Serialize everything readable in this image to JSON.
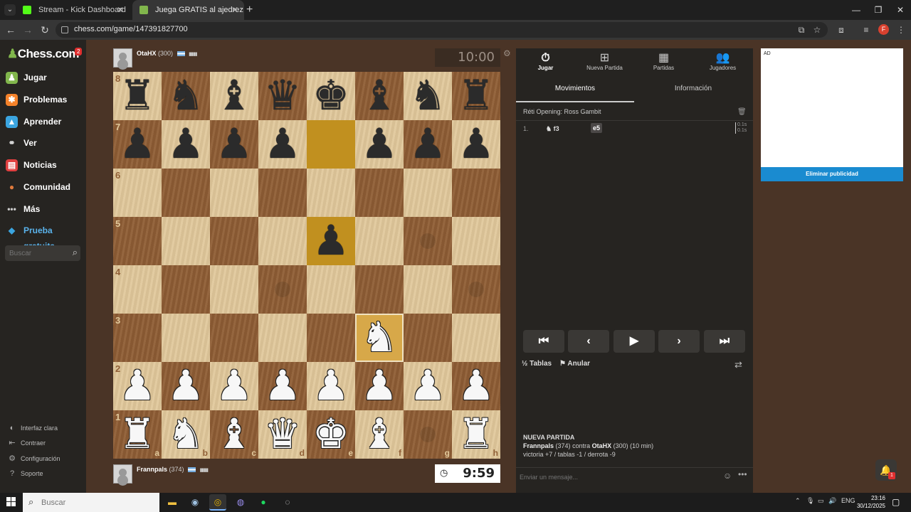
{
  "browser": {
    "tabs": [
      {
        "title": "Stream - Kick Dashboard",
        "favicon_color": "#53fc18"
      },
      {
        "title": "Juega GRATIS al ajedrez onl",
        "favicon_color": "#81b64c"
      }
    ],
    "url": "chess.com/game/147391827700"
  },
  "sidebar": {
    "logo": "Chess.com",
    "badge": "2",
    "items": [
      {
        "label": "Jugar",
        "icon": "play-icon",
        "color": "#81b64c"
      },
      {
        "label": "Problemas",
        "icon": "puzzle-icon",
        "color": "#f5822a"
      },
      {
        "label": "Aprender",
        "icon": "learn-icon",
        "color": "#3ba5e0"
      },
      {
        "label": "Ver",
        "icon": "binoculars-icon",
        "color": "#cccccc"
      },
      {
        "label": "Noticias",
        "icon": "news-icon",
        "color": "#e04040"
      },
      {
        "label": "Comunidad",
        "icon": "community-icon",
        "color": "#e07a3c"
      },
      {
        "label": "Más",
        "icon": "more-icon",
        "color": "#cccccc"
      },
      {
        "label": "Prueba gratuita",
        "icon": "diamond-icon",
        "color": "#3ba5e0"
      }
    ],
    "search_placeholder": "Buscar",
    "footer": [
      {
        "label": "Interfaz clara",
        "icon": "theme-icon"
      },
      {
        "label": "Contraer",
        "icon": "collapse-icon"
      },
      {
        "label": "Configuración",
        "icon": "settings-icon"
      },
      {
        "label": "Soporte",
        "icon": "help-icon"
      }
    ]
  },
  "players": {
    "top": {
      "name": "OtaHX",
      "rating": "(300)",
      "clock": "10:00"
    },
    "bottom": {
      "name": "Frannpals",
      "rating": "(374)",
      "clock": "9:59"
    }
  },
  "board": {
    "ranks": [
      "8",
      "7",
      "6",
      "5",
      "4",
      "3",
      "2",
      "1"
    ],
    "files": [
      "a",
      "b",
      "c",
      "d",
      "e",
      "f",
      "g",
      "h"
    ],
    "position": [
      [
        "bR",
        "bN",
        "bB",
        "bQ",
        "bK",
        "bB",
        "bN",
        "bR"
      ],
      [
        "bP",
        "bP",
        "bP",
        "bP",
        "",
        "bP",
        "bP",
        "bP"
      ],
      [
        "",
        "",
        "",
        "",
        "",
        "",
        "",
        ""
      ],
      [
        "",
        "",
        "",
        "",
        "bP",
        "",
        "",
        ""
      ],
      [
        "",
        "",
        "",
        "",
        "",
        "",
        "",
        ""
      ],
      [
        "",
        "",
        "",
        "",
        "",
        "wN",
        "",
        ""
      ],
      [
        "wP",
        "wP",
        "wP",
        "wP",
        "wP",
        "wP",
        "wP",
        "wP"
      ],
      [
        "wR",
        "wN",
        "wB",
        "wQ",
        "wK",
        "wB",
        "",
        "wR"
      ]
    ],
    "highlights": [
      "e7",
      "e5",
      "f3"
    ],
    "move_hints": [
      "g5",
      "d4",
      "h4",
      "g1"
    ]
  },
  "panel": {
    "tabs": [
      {
        "label": "Jugar",
        "icon": "stopwatch-icon"
      },
      {
        "label": "Nueva Partida",
        "icon": "plus-icon"
      },
      {
        "label": "Partidas",
        "icon": "board-icon"
      },
      {
        "label": "Jugadores",
        "icon": "players-icon"
      }
    ],
    "subtabs": [
      "Movimientos",
      "Información"
    ],
    "opening": "Réti Opening: Ross Gambit",
    "moves": [
      {
        "num": "1.",
        "white": "f3",
        "black": "e5",
        "time_w": "0.1s",
        "time_b": "0.1s"
      }
    ],
    "actions": {
      "draw": "Tablas",
      "abort": "Anular"
    },
    "new_game": {
      "title": "NUEVA PARTIDA",
      "p1": "Frannpals",
      "p1_rating": "(374)",
      "vs": "contra",
      "p2": "OtaHX",
      "p2_rating": "(300)",
      "time": "(10 min)",
      "stakes": "victoria +7 / tablas -1 / derrota -9"
    },
    "chat_placeholder": "Enviar un mensaje..."
  },
  "ad": {
    "label": "AD",
    "remove": "Eliminar publicidad"
  },
  "notifications": {
    "count": "1"
  },
  "taskbar": {
    "search": "Buscar",
    "lang": "ENG",
    "time": "23:16",
    "date": "30/12/2025"
  }
}
